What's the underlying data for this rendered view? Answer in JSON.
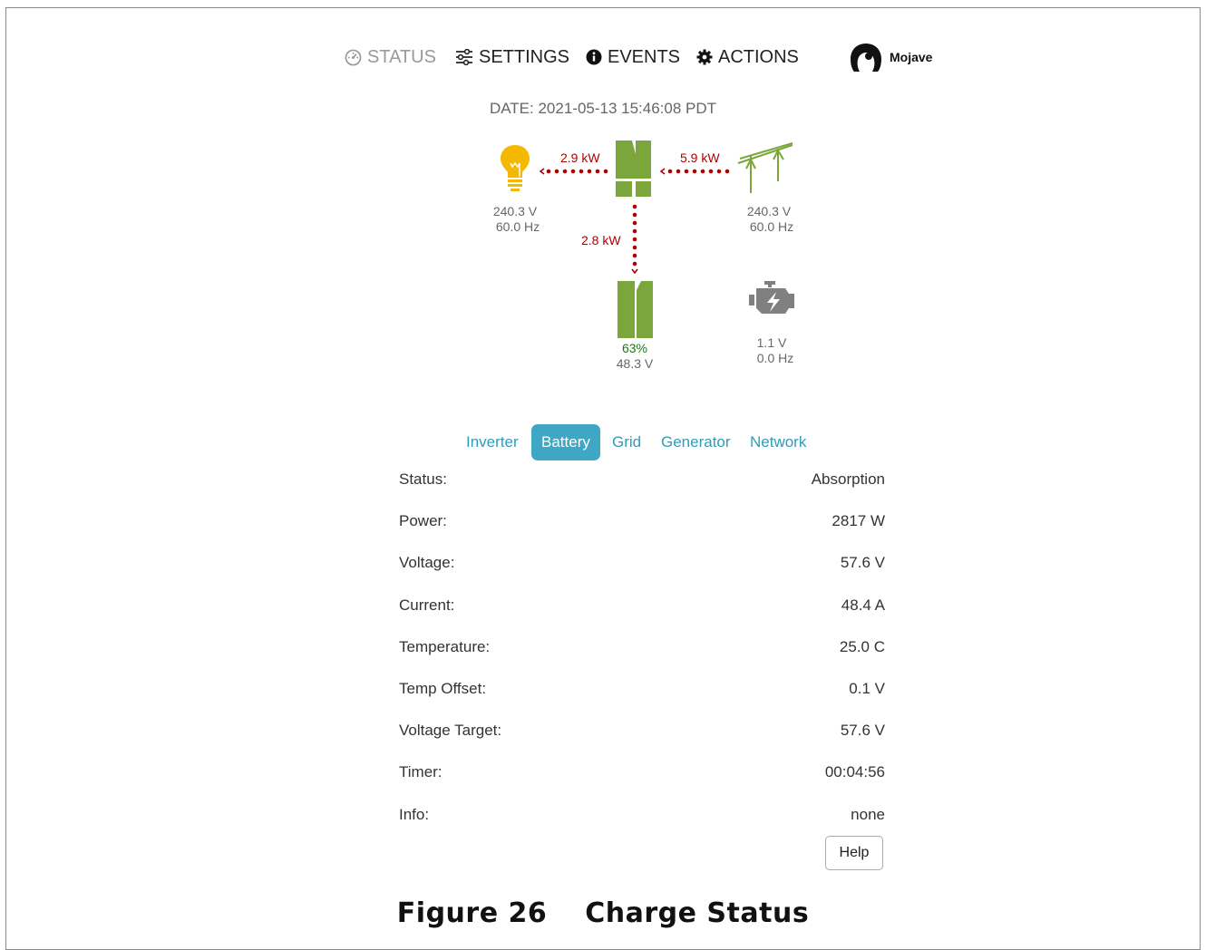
{
  "nav": {
    "status": "STATUS",
    "settings": "SETTINGS",
    "events": "EVENTS",
    "actions": "ACTIONS",
    "brand": "Mojave"
  },
  "date": "DATE: 2021-05-13 15:46:08 PDT",
  "diagram": {
    "load": {
      "voltage": "240.3 V",
      "frequency": "60.0 Hz",
      "icon": "light-bulb-icon"
    },
    "grid": {
      "voltage": "240.3 V",
      "frequency": "60.0 Hz",
      "icon": "power-line-icon"
    },
    "battery": {
      "soc": "63%",
      "voltage": "48.3 V",
      "icon": "battery-icon"
    },
    "generator": {
      "voltage": "1.1 V",
      "frequency": "0.0 Hz",
      "icon": "engine-icon"
    },
    "inverter": {
      "icon": "inverter-icon"
    },
    "flows": {
      "inverter_to_load": "2.9 kW",
      "grid_to_inverter": "5.9 kW",
      "inverter_to_battery": "2.8 kW"
    },
    "colors": {
      "flow": "#b20000",
      "device": "#7aa63c",
      "bulb": "#f5b800",
      "generator": "#808080"
    }
  },
  "tabs": [
    {
      "label": "Inverter",
      "active": false
    },
    {
      "label": "Battery",
      "active": true
    },
    {
      "label": "Grid",
      "active": false
    },
    {
      "label": "Generator",
      "active": false
    },
    {
      "label": "Network",
      "active": false
    }
  ],
  "battery_details": [
    {
      "label": "Status:",
      "value": "Absorption"
    },
    {
      "label": "Power:",
      "value": "2817 W"
    },
    {
      "label": "Voltage:",
      "value": "57.6 V"
    },
    {
      "label": "Current:",
      "value": "48.4 A"
    },
    {
      "label": "Temperature:",
      "value": "25.0 C"
    },
    {
      "label": "Temp Offset:",
      "value": "0.1 V"
    },
    {
      "label": "Voltage Target:",
      "value": "57.6 V"
    },
    {
      "label": "Timer:",
      "value": "00:04:56"
    },
    {
      "label": "Info:",
      "value": "none"
    }
  ],
  "help_label": "Help",
  "caption": {
    "number": "Figure 26",
    "title": "Charge Status"
  }
}
